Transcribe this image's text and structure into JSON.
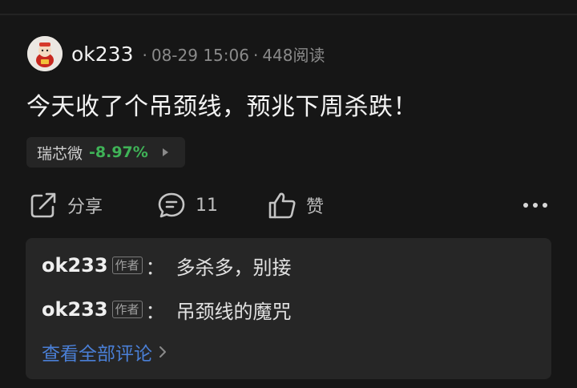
{
  "post": {
    "author": "ok233",
    "date": "08-29 15:06",
    "reads": "448阅读",
    "separator": "·",
    "text": "今天收了个吊颈线，预兆下周杀跌！"
  },
  "stock": {
    "name": "瑞芯微",
    "change": "-8.97%",
    "change_color": "#3fb357"
  },
  "actions": {
    "share_label": "分享",
    "comment_count": "11",
    "like_label": "赞"
  },
  "comments": [
    {
      "author": "ok233",
      "tag": "作者",
      "colon": "：",
      "text": "多杀多，别接"
    },
    {
      "author": "ok233",
      "tag": "作者",
      "colon": "：",
      "text": "吊颈线的魔咒"
    }
  ],
  "view_all": "查看全部评论",
  "colors": {
    "background": "#161616",
    "card": "#262626",
    "link": "#4a7fd6"
  }
}
